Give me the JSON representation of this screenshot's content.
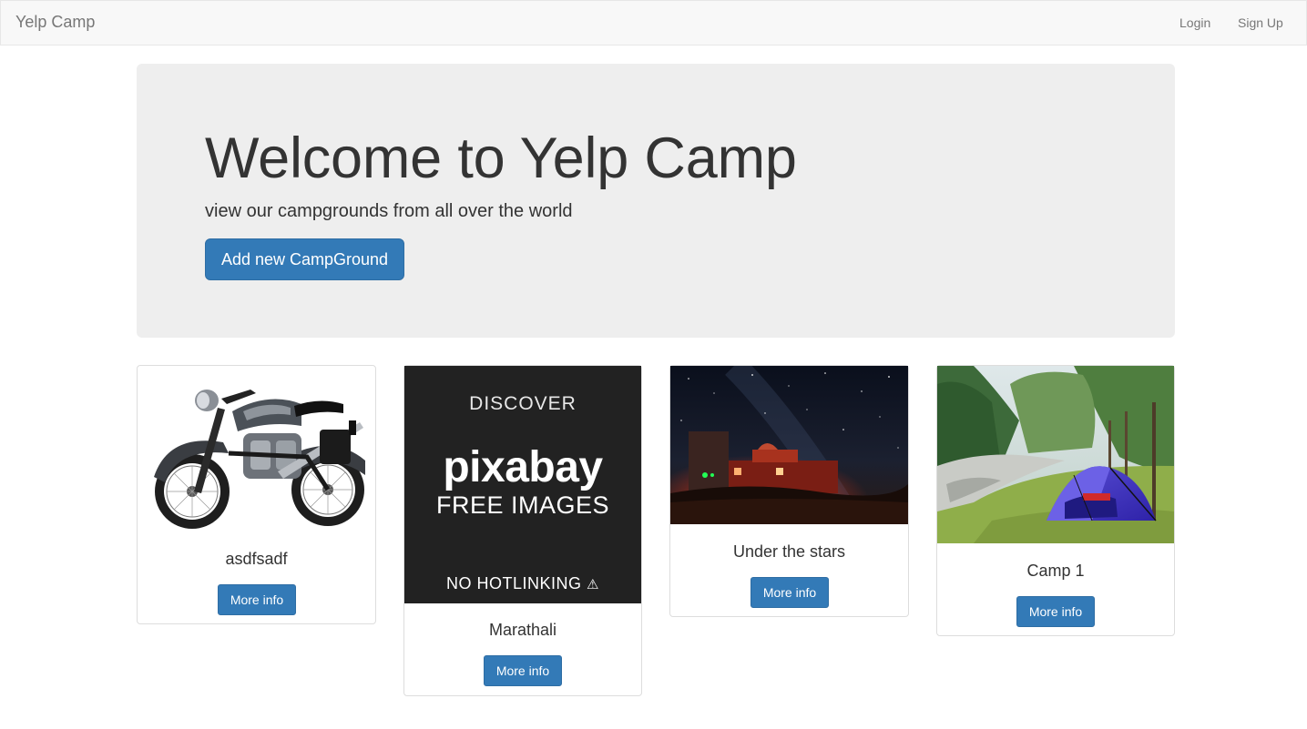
{
  "navbar": {
    "brand": "Yelp Camp",
    "login": "Login",
    "signup": "Sign Up"
  },
  "jumbotron": {
    "title": "Welcome to Yelp Camp",
    "subtitle": "view our campgrounds from all over the world",
    "add_button": "Add new CampGround"
  },
  "campgrounds": [
    {
      "name": "asdfsadf",
      "button": "More info",
      "image": "motorcycle-photo"
    },
    {
      "name": "Marathali",
      "button": "More info",
      "image": "pixabay-placeholder"
    },
    {
      "name": "Under the stars",
      "button": "More info",
      "image": "night-observatory-photo"
    },
    {
      "name": "Camp 1",
      "button": "More info",
      "image": "tent-meadow-photo"
    }
  ],
  "pixabay": {
    "discover": "DISCOVER",
    "logo": "pixabay",
    "free_images": "FREE IMAGES",
    "no_hotlinking": "NO HOTLINKING",
    "warning_glyph": "⚠"
  },
  "colors": {
    "primary": "#337ab7",
    "navbar_bg": "#f8f8f8",
    "jumbotron_bg": "#eeeeee"
  }
}
